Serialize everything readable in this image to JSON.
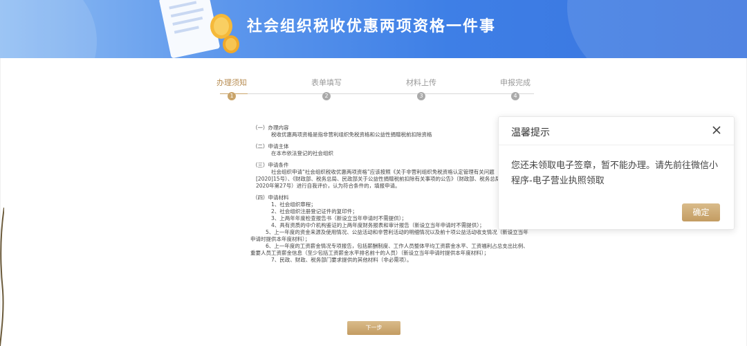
{
  "header": {
    "title": "社会组织税收优惠两项资格一件事"
  },
  "steps": [
    {
      "label": "办理须知",
      "num": "1",
      "active": true
    },
    {
      "label": "表单填写",
      "num": "2",
      "active": false
    },
    {
      "label": "材料上传",
      "num": "3",
      "active": false
    },
    {
      "label": "申报完成",
      "num": "4",
      "active": false
    }
  ],
  "content": {
    "s1": {
      "heading": "（一）办理内容",
      "text": "税收优惠两项资格是指非营利组织免税资格和公益性捐赠税前扣除资格"
    },
    "s2": {
      "heading": "（二）申请主体",
      "text": "在本市依法登记的社会组织"
    },
    "s3": {
      "heading": "（三）申请条件",
      "text": "社会组织申请“社会组织税收优惠两项资格”应该按照《关于非营利组织免税资格认定管理有关问题（沪财发[2020]15号）、《财政部、税务总局、民政部关于公益性捐赠税前扣除有关事项的公告》（财政部、税务总局、民政部公告2020年第27号）进行自我评价，认为符合条件的，填报申请。"
    },
    "s4": {
      "heading": "（四）申请材料",
      "items": [
        "1、社会组织章程；",
        "2、社会组织注册登记证件的复印件；",
        "3、上两年年度检查报告书（新设立当年申请时不需提供）；",
        "4、具有资质的中介机构鉴证的上两年度财务报表和审计报告（新设立当年申请时不需提供）；",
        "5、上一年度的资金来源及使用情况、公益活动和非营利活动的明细情况以及前十项公益活动收支情况（新设立当年申请时提供本年度材料）；",
        "6、上一年度的工资薪金情况专项报告，包括薪酬制度、工作人员整体平均工资薪金水平、工资福利占总支出比例、重要人员工资薪金信息（至少包括工资薪金水平排名前十的人员）（新设立当年申请时提供本年度材料）；",
        "7、民政、财政、税务部门要求提供的其他材料（非必需项）。"
      ]
    }
  },
  "next_button": {
    "label": "下一步"
  },
  "modal": {
    "title": "温馨提示",
    "message": "您还未领取电子签章，暂不能办理。请先前往微信小程序-电子营业执照领取",
    "ok_label": "确定"
  }
}
